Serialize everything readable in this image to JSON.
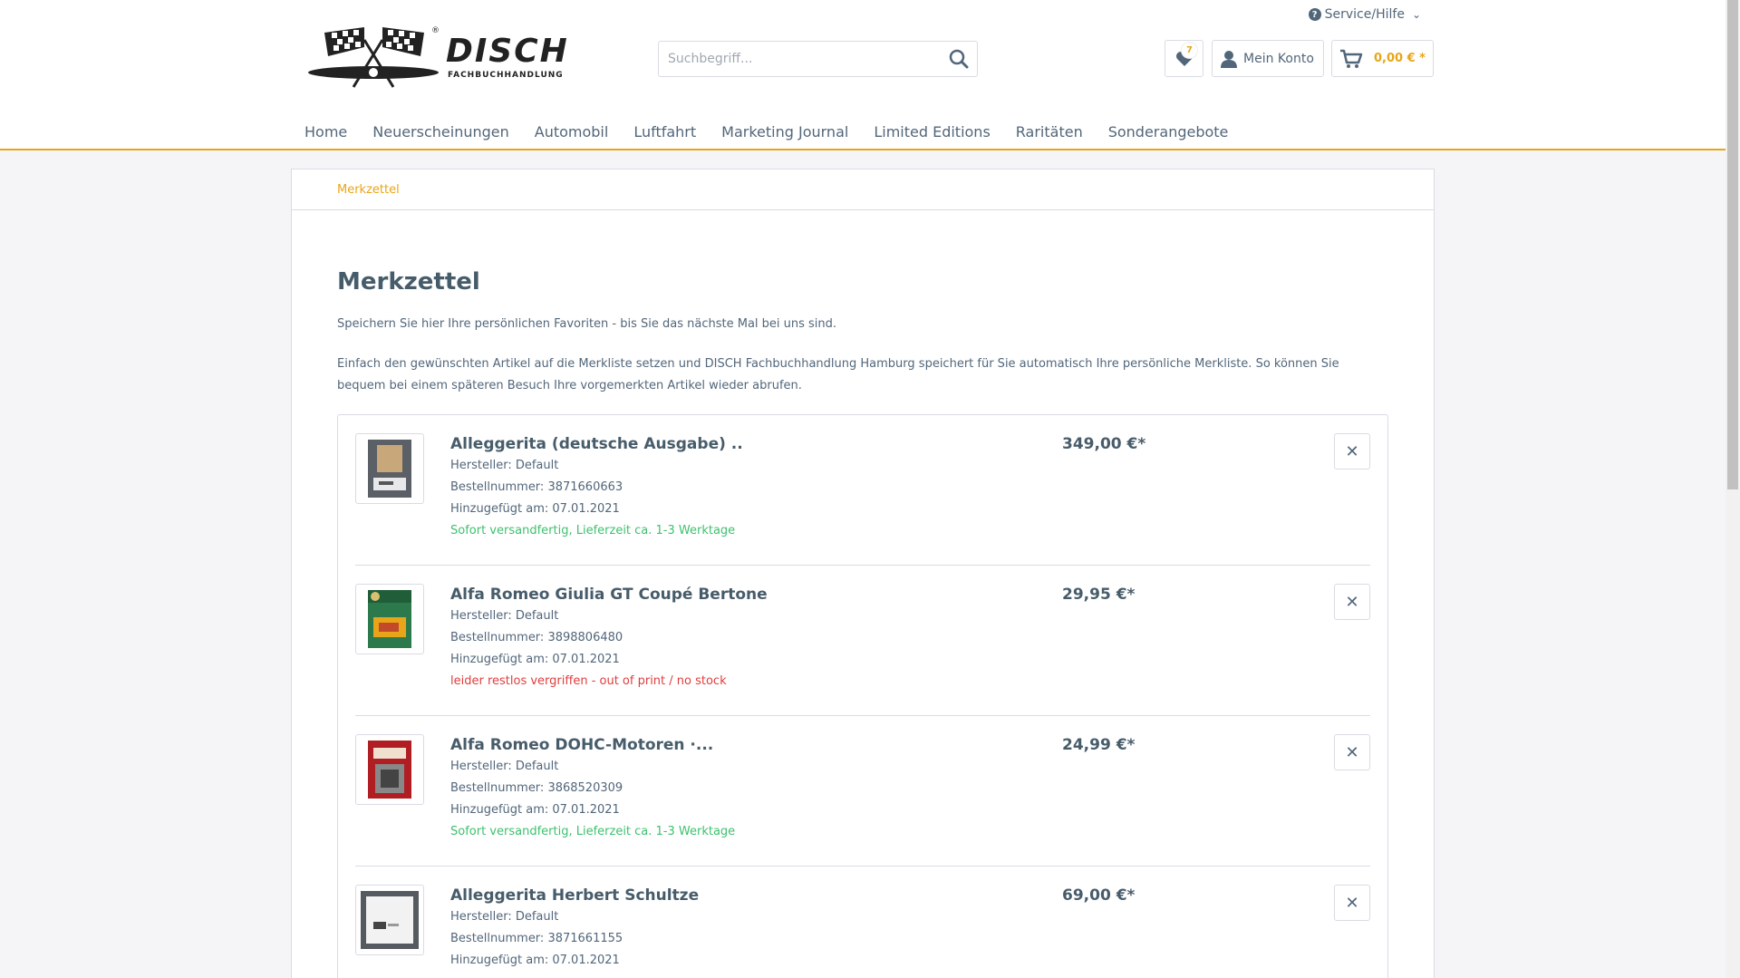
{
  "header": {
    "service_label": "Service/Hilfe",
    "logo": {
      "name": "DISCH",
      "subtitle": "FACHBUCHHANDLUNG"
    },
    "search": {
      "placeholder": "Suchbegriff..."
    },
    "notepad_count": "7",
    "account_label": "Mein Konto",
    "cart_amount": "0,00 € *"
  },
  "nav": {
    "items": [
      {
        "label": "Home"
      },
      {
        "label": "Neuerscheinungen"
      },
      {
        "label": "Automobil"
      },
      {
        "label": "Luftfahrt"
      },
      {
        "label": "Marketing Journal"
      },
      {
        "label": "Limited Editions"
      },
      {
        "label": "Raritäten"
      },
      {
        "label": "Sonderangebote"
      }
    ]
  },
  "breadcrumb": "Merkzettel",
  "page": {
    "title": "Merkzettel",
    "intro1": "Speichern Sie hier Ihre persönlichen Favoriten - bis Sie das nächste Mal bei uns sind.",
    "intro2": "Einfach den gewünschten Artikel auf die Merkliste setzen und DISCH Fachbuchhandlung Hamburg speichert für Sie automatisch Ihre persönliche Merkliste. So können Sie bequem bei einem späteren Besuch Ihre vorgemerkten Artikel wieder abrufen."
  },
  "items": [
    {
      "title": "Alleggerita (deutsche Ausgabe) ..",
      "manufacturer": "Hersteller: Default",
      "order_number": "Bestellnummer: 3871660663",
      "added": "Hinzugefügt am: 07.01.2021",
      "availability": "Sofort versandfertig, Lieferzeit ca. 1-3 Werktage",
      "in_stock": true,
      "price": "349,00 €*"
    },
    {
      "title": "Alfa Romeo Giulia GT Coupé Bertone",
      "manufacturer": "Hersteller: Default",
      "order_number": "Bestellnummer: 3898806480",
      "added": "Hinzugefügt am: 07.01.2021",
      "availability": "leider restlos vergriffen - out of print / no stock",
      "in_stock": false,
      "price": "29,95 €*"
    },
    {
      "title": "Alfa Romeo DOHC-Motoren ·...",
      "manufacturer": "Hersteller: Default",
      "order_number": "Bestellnummer: 3868520309",
      "added": "Hinzugefügt am: 07.01.2021",
      "availability": "Sofort versandfertig, Lieferzeit ca. 1-3 Werktage",
      "in_stock": true,
      "price": "24,99 €*"
    },
    {
      "title": "Alleggerita Herbert Schultze",
      "manufacturer": "Hersteller: Default",
      "order_number": "Bestellnummer: 3871661155",
      "added": "Hinzugefügt am: 07.01.2021",
      "availability": "",
      "in_stock": true,
      "price": "69,00 €*"
    }
  ],
  "colors": {
    "accent": "#e8a519",
    "text": "#52667a",
    "in_stock": "#3ec16e",
    "out_of_stock": "#e13d3d"
  }
}
